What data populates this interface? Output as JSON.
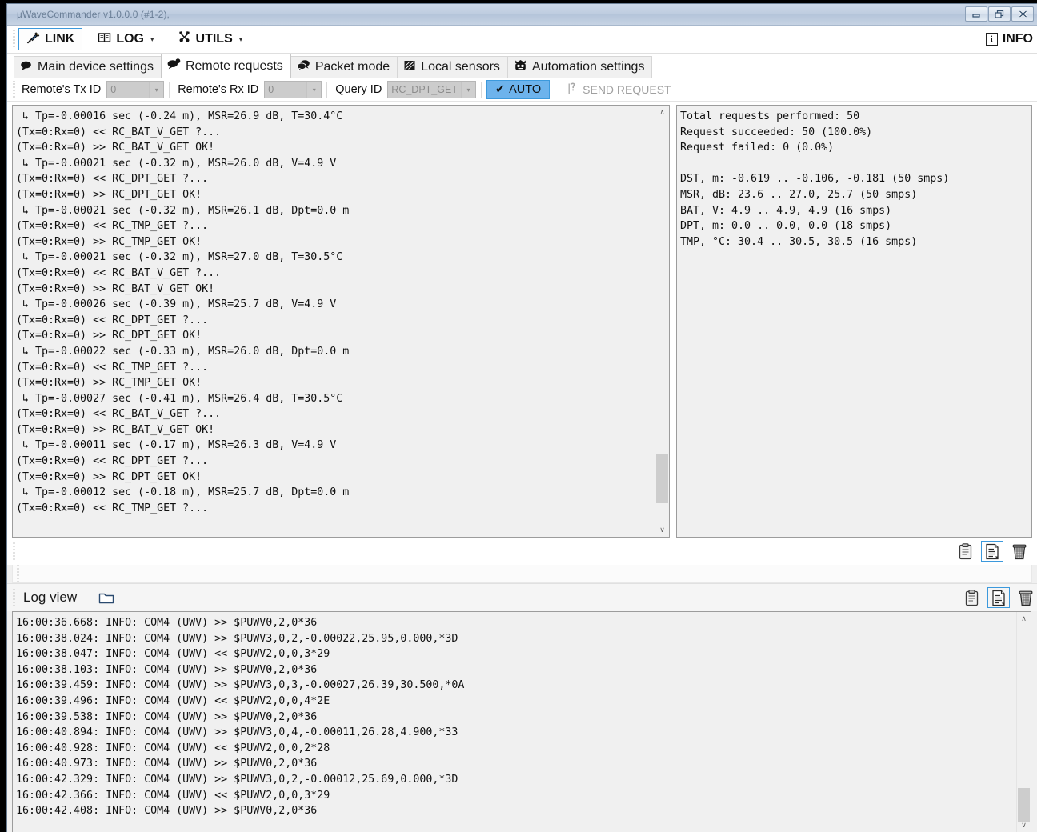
{
  "window": {
    "title": "µWaveCommander v1.0.0.0 (#1-2),",
    "minimize_label": "minimize",
    "restore_label": "restore",
    "close_label": "close"
  },
  "main_toolbar": {
    "buttons": [
      {
        "label": "LINK",
        "icon": "plug-icon",
        "has_caret": false,
        "focused": true
      },
      {
        "label": "LOG",
        "icon": "book-icon",
        "has_caret": true,
        "focused": false
      },
      {
        "label": "UTILS",
        "icon": "tools-icon",
        "has_caret": true,
        "focused": false
      }
    ],
    "info_label": "INFO",
    "info_icon": "info-icon",
    "caret_glyph": "▾"
  },
  "tabs": [
    {
      "label": "Main device settings",
      "icon": "speech-bubble-icon",
      "active": false
    },
    {
      "label": "Remote requests",
      "icon": "speech-bubbles-icon",
      "active": true
    },
    {
      "label": "Packet mode",
      "icon": "speech-bubbles-dark-icon",
      "active": false
    },
    {
      "label": "Local sensors",
      "icon": "sensor-icon",
      "active": false
    },
    {
      "label": "Automation settings",
      "icon": "robot-icon",
      "active": false
    }
  ],
  "request_toolbar": {
    "tx_id_label": "Remote's Tx ID",
    "tx_id_value": "0",
    "rx_id_label": "Remote's Rx ID",
    "rx_id_value": "0",
    "query_id_label": "Query ID",
    "query_id_value": "RC_DPT_GET",
    "auto_label": "AUTO",
    "auto_check_glyph": "✔",
    "auto_active": true,
    "send_label": "SEND REQUEST",
    "send_icon": "question-flag-icon",
    "send_enabled": false,
    "dropdown_arrow_glyph": "▾",
    "accent_color": "#6db3ec",
    "accent_border_color": "#3c99dc"
  },
  "request_log": {
    "lines": [
      " ↳ Tp=-0.00016 sec (-0.24 m), MSR=26.9 dB, T=30.4°C",
      "(Tx=0:Rx=0) << RC_BAT_V_GET ?...",
      "(Tx=0:Rx=0) >> RC_BAT_V_GET OK!",
      " ↳ Tp=-0.00021 sec (-0.32 m), MSR=26.0 dB, V=4.9 V",
      "(Tx=0:Rx=0) << RC_DPT_GET ?...",
      "(Tx=0:Rx=0) >> RC_DPT_GET OK!",
      " ↳ Tp=-0.00021 sec (-0.32 m), MSR=26.1 dB, Dpt=0.0 m",
      "(Tx=0:Rx=0) << RC_TMP_GET ?...",
      "(Tx=0:Rx=0) >> RC_TMP_GET OK!",
      " ↳ Tp=-0.00021 sec (-0.32 m), MSR=27.0 dB, T=30.5°C",
      "(Tx=0:Rx=0) << RC_BAT_V_GET ?...",
      "(Tx=0:Rx=0) >> RC_BAT_V_GET OK!",
      " ↳ Tp=-0.00026 sec (-0.39 m), MSR=25.7 dB, V=4.9 V",
      "(Tx=0:Rx=0) << RC_DPT_GET ?...",
      "(Tx=0:Rx=0) >> RC_DPT_GET OK!",
      " ↳ Tp=-0.00022 sec (-0.33 m), MSR=26.0 dB, Dpt=0.0 m",
      "(Tx=0:Rx=0) << RC_TMP_GET ?...",
      "(Tx=0:Rx=0) >> RC_TMP_GET OK!",
      " ↳ Tp=-0.00027 sec (-0.41 m), MSR=26.4 dB, T=30.5°C",
      "(Tx=0:Rx=0) << RC_BAT_V_GET ?...",
      "(Tx=0:Rx=0) >> RC_BAT_V_GET OK!",
      " ↳ Tp=-0.00011 sec (-0.17 m), MSR=26.3 dB, V=4.9 V",
      "(Tx=0:Rx=0) << RC_DPT_GET ?...",
      "(Tx=0:Rx=0) >> RC_DPT_GET OK!",
      " ↳ Tp=-0.00012 sec (-0.18 m), MSR=25.7 dB, Dpt=0.0 m",
      "(Tx=0:Rx=0) << RC_TMP_GET ?..."
    ]
  },
  "statistics": {
    "lines": [
      "Total requests performed: 50",
      "Request succeeded: 50 (100.0%)",
      "Request failed: 0 (0.0%)",
      "",
      "DST, m: -0.619 .. -0.106, -0.181 (50 smps)",
      "MSR, dB: 23.6 .. 27.0, 25.7 (50 smps)",
      "BAT, V: 4.9 .. 4.9, 4.9 (16 smps)",
      "DPT, m: 0.0 .. 0.0, 0.0 (18 smps)",
      "TMP, °C: 30.4 .. 30.5, 30.5 (16 smps)"
    ]
  },
  "pane_icons": {
    "copy_label": "copy-to-clipboard",
    "save_label": "save-to-file",
    "clear_label": "clear",
    "selected": "save-to-file"
  },
  "logview": {
    "title": "Log view",
    "folder_icon": "folder-icon",
    "copy_label": "copy-to-clipboard",
    "save_label": "save-to-file",
    "clear_label": "clear",
    "lines": [
      "16:00:36.668: INFO: COM4 (UWV) >> $PUWV0,2,0*36",
      "16:00:38.024: INFO: COM4 (UWV) >> $PUWV3,0,2,-0.00022,25.95,0.000,*3D",
      "16:00:38.047: INFO: COM4 (UWV) << $PUWV2,0,0,3*29",
      "16:00:38.103: INFO: COM4 (UWV) >> $PUWV0,2,0*36",
      "16:00:39.459: INFO: COM4 (UWV) >> $PUWV3,0,3,-0.00027,26.39,30.500,*0A",
      "16:00:39.496: INFO: COM4 (UWV) << $PUWV2,0,0,4*2E",
      "16:00:39.538: INFO: COM4 (UWV) >> $PUWV0,2,0*36",
      "16:00:40.894: INFO: COM4 (UWV) >> $PUWV3,0,4,-0.00011,26.28,4.900,*33",
      "16:00:40.928: INFO: COM4 (UWV) << $PUWV2,0,0,2*28",
      "16:00:40.973: INFO: COM4 (UWV) >> $PUWV0,2,0*36",
      "16:00:42.329: INFO: COM4 (UWV) >> $PUWV3,0,2,-0.00012,25.69,0.000,*3D",
      "16:00:42.366: INFO: COM4 (UWV) << $PUWV2,0,0,3*29",
      "16:00:42.408: INFO: COM4 (UWV) >> $PUWV0,2,0*36"
    ]
  },
  "scrollbars": {
    "up_glyph": "∧",
    "down_glyph": "∨"
  }
}
